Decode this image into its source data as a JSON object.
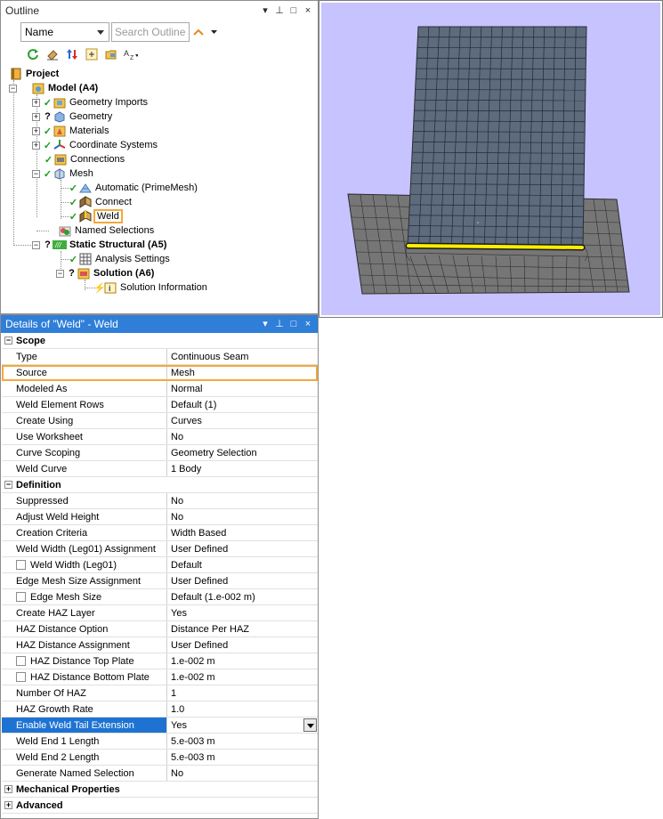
{
  "outline": {
    "title": "Outline",
    "title_buttons": [
      "▾",
      "⊥",
      "□",
      "×"
    ],
    "filter": {
      "value": "Name",
      "search_placeholder": "Search Outline"
    },
    "tree": {
      "project": "Project",
      "model": "Model (A4)",
      "geometry_imports": "Geometry Imports",
      "geometry": "Geometry",
      "materials": "Materials",
      "coordinate_systems": "Coordinate Systems",
      "connections": "Connections",
      "mesh": "Mesh",
      "automatic": "Automatic (PrimeMesh)",
      "connect": "Connect",
      "weld": "Weld",
      "named_selections": "Named Selections",
      "static_structural": "Static Structural (A5)",
      "analysis_settings": "Analysis Settings",
      "solution": "Solution (A6)",
      "solution_information": "Solution Information"
    }
  },
  "details": {
    "title": "Details of \"Weld\" - Weld",
    "title_buttons": [
      "▾",
      "⊥",
      "□",
      "×"
    ],
    "categories": {
      "scope": "Scope",
      "definition": "Definition",
      "mechanical": "Mechanical Properties",
      "advanced": "Advanced"
    },
    "scope_rows": [
      {
        "name": "Type",
        "value": "Continuous Seam"
      },
      {
        "name": "Source",
        "value": "Mesh"
      },
      {
        "name": "Modeled As",
        "value": "Normal"
      },
      {
        "name": "Weld Element Rows",
        "value": "Default (1)"
      },
      {
        "name": "Create Using",
        "value": "Curves"
      },
      {
        "name": "Use Worksheet",
        "value": "No"
      },
      {
        "name": "Curve Scoping",
        "value": "Geometry Selection"
      },
      {
        "name": "Weld Curve",
        "value": "1 Body"
      }
    ],
    "definition_rows": [
      {
        "name": "Suppressed",
        "value": "No"
      },
      {
        "name": "Adjust Weld Height",
        "value": "No"
      },
      {
        "name": "Creation Criteria",
        "value": "Width Based"
      },
      {
        "name": "Weld Width (Leg01) Assignment",
        "value": "User Defined"
      },
      {
        "name": "Weld Width (Leg01)",
        "value": "Default"
      },
      {
        "name": "Edge Mesh Size Assignment",
        "value": "User Defined"
      },
      {
        "name": "Edge Mesh Size",
        "value": "Default (1.e-002 m)"
      },
      {
        "name": "Create HAZ Layer",
        "value": "Yes"
      },
      {
        "name": "HAZ Distance Option",
        "value": "Distance Per HAZ"
      },
      {
        "name": "HAZ Distance Assignment",
        "value": "User Defined"
      },
      {
        "name": "HAZ Distance Top Plate",
        "value": "1.e-002 m"
      },
      {
        "name": "HAZ Distance Bottom Plate",
        "value": "1.e-002 m"
      },
      {
        "name": "Number Of HAZ",
        "value": "1"
      },
      {
        "name": "HAZ Growth Rate",
        "value": "1.0"
      },
      {
        "name": "Enable Weld Tail Extension",
        "value": "Yes"
      },
      {
        "name": "Weld End 1 Length",
        "value": "5.e-003 m"
      },
      {
        "name": "Weld End 2 Length",
        "value": "5.e-003 m"
      },
      {
        "name": "Generate Named Selection",
        "value": "No"
      }
    ]
  },
  "colors": {
    "accent": "#2f7ed8",
    "highlight": "#f2a93b",
    "viewport_bg": "#c7c3ff",
    "mesh_fill": "#5d6b7c",
    "mesh_line": "#1e2630",
    "weld": "#ffee00"
  }
}
